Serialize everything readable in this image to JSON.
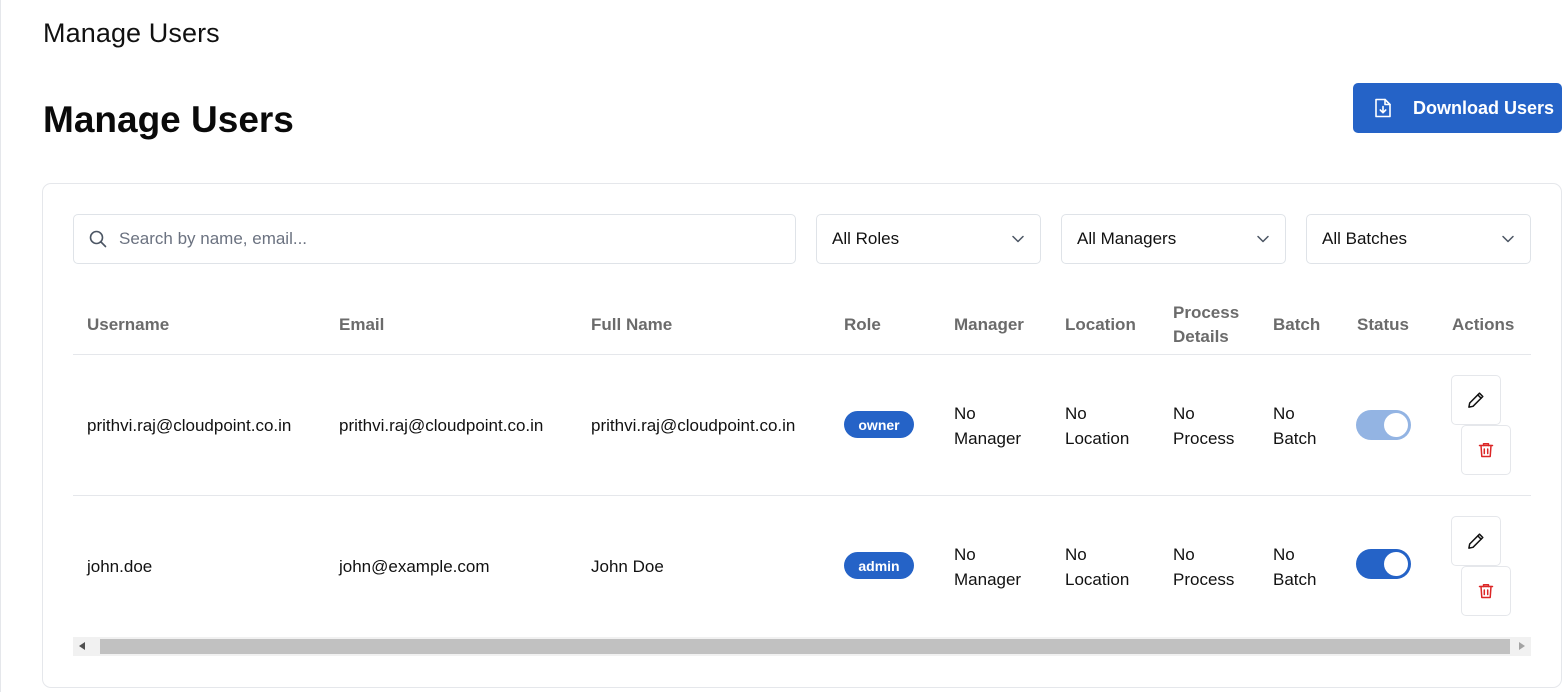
{
  "header": {
    "breadcrumb_title": "Manage Users",
    "page_title": "Manage Users"
  },
  "download_button": {
    "label": "Download Users",
    "icon": "file-download-icon"
  },
  "filters": {
    "search_placeholder": "Search by name, email...",
    "search_value": "",
    "role": "All Roles",
    "manager": "All Managers",
    "batch": "All Batches"
  },
  "table": {
    "columns": [
      "Username",
      "Email",
      "Full Name",
      "Role",
      "Manager",
      "Location",
      "Process Details",
      "Batch",
      "Status",
      "Actions"
    ],
    "rows": [
      {
        "username": "prithvi.raj@cloudpoint.co.in",
        "email": "prithvi.raj@cloudpoint.co.in",
        "full_name": "prithvi.raj@cloudpoint.co.in",
        "role": "owner",
        "manager": "No Manager",
        "location": "No Location",
        "process": "No Process",
        "batch": "No Batch",
        "status_on": true,
        "status_disabled": true
      },
      {
        "username": "john.doe",
        "email": "john@example.com",
        "full_name": "John Doe",
        "role": "admin",
        "manager": "No Manager",
        "location": "No Location",
        "process": "No Process",
        "batch": "No Batch",
        "status_on": true,
        "status_disabled": false
      }
    ]
  },
  "colors": {
    "primary": "#2563c7",
    "toggle_disabled": "#93b4e3",
    "danger": "#dc2626",
    "header_text": "#6b6b6b"
  },
  "icons": {
    "search": "search-icon",
    "chevron": "chevron-down-icon",
    "edit": "pencil-icon",
    "delete": "trash-icon"
  }
}
